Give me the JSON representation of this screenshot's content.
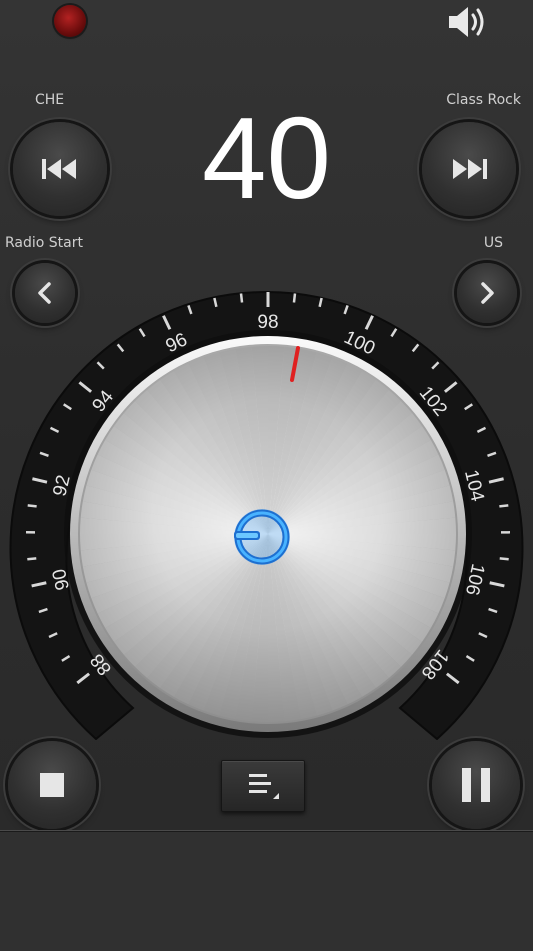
{
  "status": {
    "rec_indicator_color": "#8a1010",
    "speaker_icon": "speaker-volume-icon"
  },
  "presets": {
    "prev_label": "CHE",
    "next_label": "Class Rock",
    "left_label": "Radio Start",
    "right_label": "US"
  },
  "display": {
    "number": "40"
  },
  "dial": {
    "scale_labels": [
      "88",
      "90",
      "92",
      "94",
      "96",
      "98",
      "100",
      "102",
      "104",
      "106",
      "108"
    ],
    "needle_color": "#e02020",
    "power_color": "#2a9cff"
  },
  "controls": {
    "prev_icon": "skip-previous-icon",
    "next_icon": "skip-next-icon",
    "left_icon": "chevron-left-icon",
    "right_icon": "chevron-right-icon",
    "stop_icon": "stop-icon",
    "pause_icon": "pause-icon",
    "menu_icon": "menu-list-icon"
  }
}
